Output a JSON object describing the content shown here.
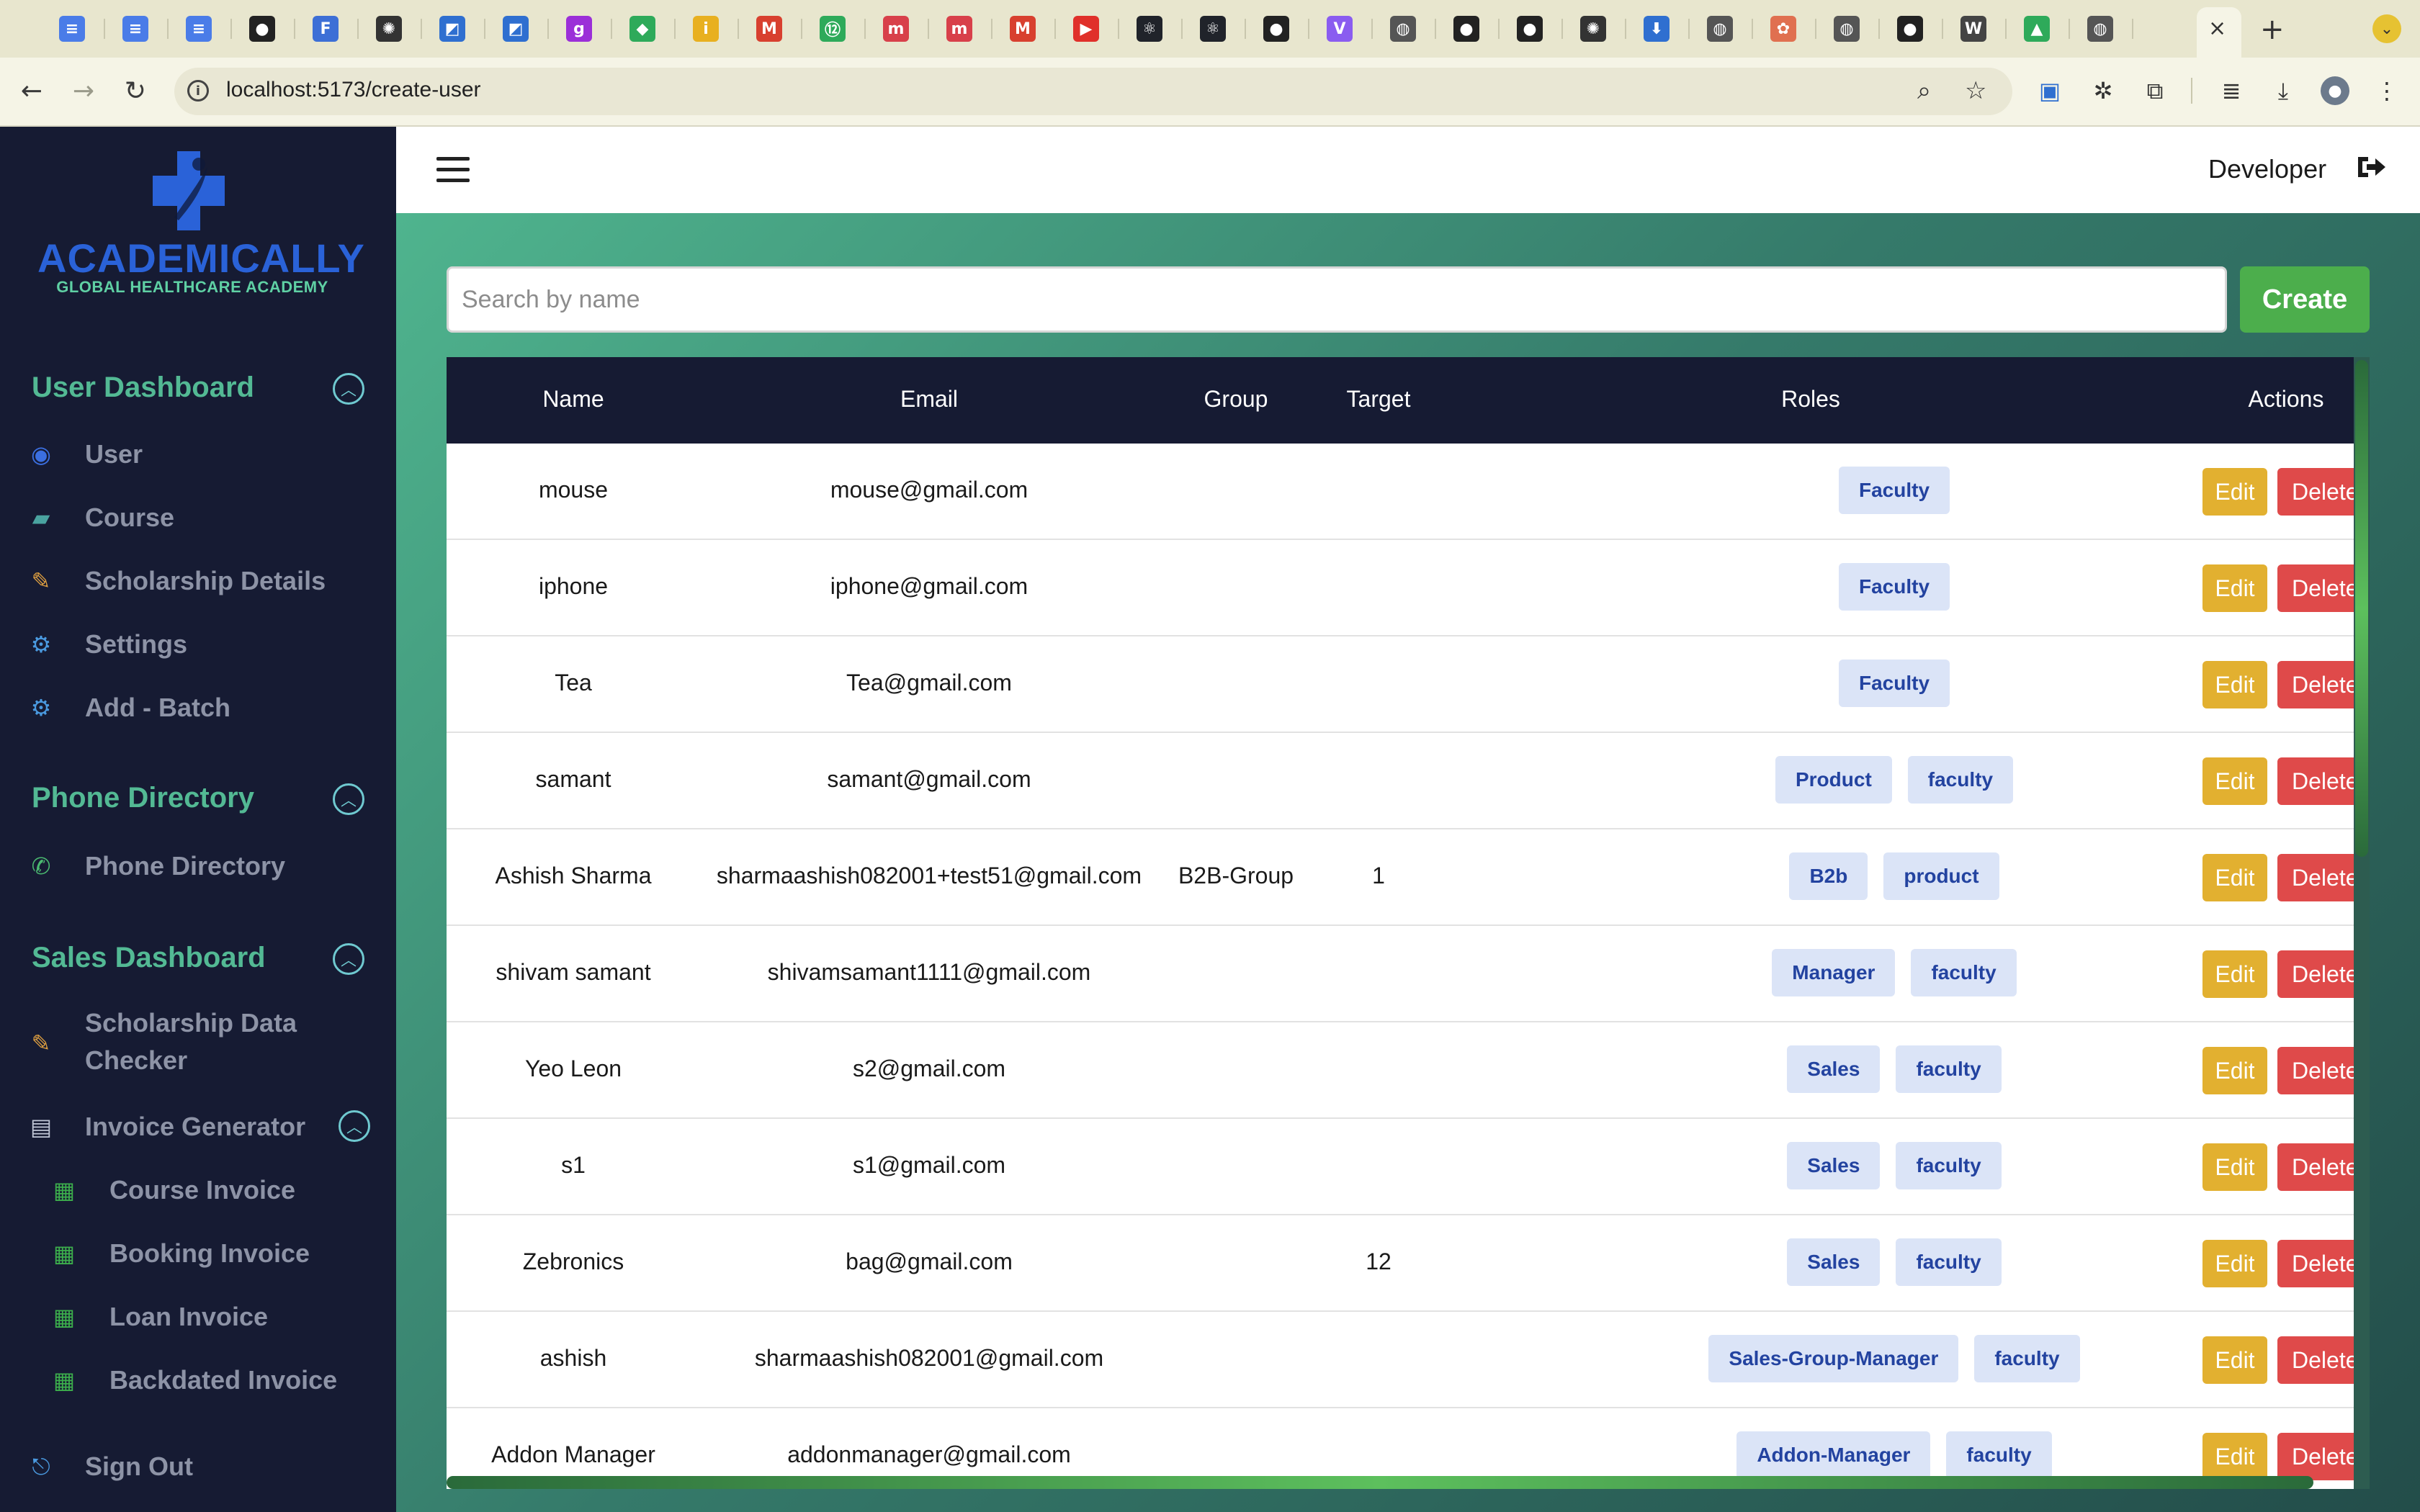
{
  "browser": {
    "url": "localhost:5173/create-user",
    "tabs": [
      {
        "icon": "docs-icon",
        "color": "#4a7ce8",
        "glyph": "≡"
      },
      {
        "icon": "docs-icon",
        "color": "#4a7ce8",
        "glyph": "≡"
      },
      {
        "icon": "docs-icon",
        "color": "#4a7ce8",
        "glyph": "≡"
      },
      {
        "icon": "github-icon",
        "color": "#222222",
        "glyph": "●"
      },
      {
        "icon": "frt-icon",
        "color": "#3d6fd6",
        "glyph": "F"
      },
      {
        "icon": "chatgpt-icon",
        "color": "#333333",
        "glyph": "✺"
      },
      {
        "icon": "sheets-app-icon",
        "color": "#2f6fd0",
        "glyph": "◩"
      },
      {
        "icon": "sheets-app-icon",
        "color": "#2f6fd0",
        "glyph": "◩"
      },
      {
        "icon": "g-icon",
        "color": "#9b2fd8",
        "glyph": "g"
      },
      {
        "icon": "maps-icon",
        "color": "#2eaa5a",
        "glyph": "◆"
      },
      {
        "icon": "idea-icon",
        "color": "#e8b020",
        "glyph": "i"
      },
      {
        "icon": "gmail-icon",
        "color": "#d8402f",
        "glyph": "M"
      },
      {
        "icon": "badge-12-icon",
        "color": "#2eaa5a",
        "glyph": "⑫"
      },
      {
        "icon": "m-icon",
        "color": "#d8404a",
        "glyph": "m"
      },
      {
        "icon": "m-icon",
        "color": "#d8404a",
        "glyph": "m"
      },
      {
        "icon": "gmail-icon",
        "color": "#d8402f",
        "glyph": "M"
      },
      {
        "icon": "youtube-icon",
        "color": "#e0302a",
        "glyph": "▶"
      },
      {
        "icon": "react-icon",
        "color": "#20232a",
        "glyph": "⚛"
      },
      {
        "icon": "react-icon",
        "color": "#20232a",
        "glyph": "⚛"
      },
      {
        "icon": "github-icon",
        "color": "#222222",
        "glyph": "●"
      },
      {
        "icon": "vite-icon",
        "color": "#8a5cf0",
        "glyph": "V"
      },
      {
        "icon": "globe-icon",
        "color": "#555555",
        "glyph": "◍"
      },
      {
        "icon": "github-icon",
        "color": "#222222",
        "glyph": "●"
      },
      {
        "icon": "github-icon",
        "color": "#222222",
        "glyph": "●"
      },
      {
        "icon": "chatgpt-icon",
        "color": "#333333",
        "glyph": "✺"
      },
      {
        "icon": "download-icon",
        "color": "#2f6fd0",
        "glyph": "⬇"
      },
      {
        "icon": "globe-icon",
        "color": "#555555",
        "glyph": "◍"
      },
      {
        "icon": "squarespace-icon",
        "color": "#e07050",
        "glyph": "✿"
      },
      {
        "icon": "globe-icon",
        "color": "#555555",
        "glyph": "◍"
      },
      {
        "icon": "github-icon",
        "color": "#222222",
        "glyph": "●"
      },
      {
        "icon": "wikipedia-icon",
        "color": "#444444",
        "glyph": "W"
      },
      {
        "icon": "drive-icon",
        "color": "#2eaa5a",
        "glyph": "▲"
      },
      {
        "icon": "globe-icon",
        "color": "#555555",
        "glyph": "◍"
      }
    ]
  },
  "sidebar": {
    "logo_title": "ACADEMICALLY",
    "logo_subtitle": "GLOBAL HEALTHCARE ACADEMY",
    "sections": {
      "user_dashboard": {
        "title": "User Dashboard",
        "items": [
          {
            "label": "User",
            "icon": "user-icon"
          },
          {
            "label": "Course",
            "icon": "course-icon"
          },
          {
            "label": "Scholarship Details",
            "icon": "scholarship-icon"
          },
          {
            "label": "Settings",
            "icon": "gear-icon"
          },
          {
            "label": "Add - Batch",
            "icon": "gear-icon"
          }
        ]
      },
      "phone_directory": {
        "title": "Phone Directory",
        "items": [
          {
            "label": "Phone Directory",
            "icon": "phone-icon"
          }
        ]
      },
      "sales_dashboard": {
        "title": "Sales Dashboard",
        "items": [
          {
            "label_line1": "Scholarship Data",
            "label_line2": "Checker",
            "icon": "scholarship-icon"
          },
          {
            "label": "Invoice Generator",
            "icon": "invoice-icon"
          }
        ],
        "invoice_items": [
          {
            "label": "Course Invoice",
            "icon": "document-icon"
          },
          {
            "label": "Booking Invoice",
            "icon": "document-icon"
          },
          {
            "label": "Loan Invoice",
            "icon": "document-icon"
          },
          {
            "label": "Backdated Invoice",
            "icon": "document-icon"
          }
        ]
      }
    },
    "sign_out": "Sign Out"
  },
  "header": {
    "user_name": "Developer"
  },
  "search": {
    "placeholder": "Search by name"
  },
  "create_label": "Create",
  "table": {
    "columns": [
      "Name",
      "Email",
      "Group",
      "Target",
      "Roles",
      "Actions"
    ],
    "edit_label": "Edit",
    "delete_label": "Delete",
    "rows": [
      {
        "name": "mouse",
        "email": "mouse@gmail.com",
        "group": "",
        "target": "",
        "roles": [
          "Faculty"
        ]
      },
      {
        "name": "iphone",
        "email": "iphone@gmail.com",
        "group": "",
        "target": "",
        "roles": [
          "Faculty"
        ]
      },
      {
        "name": "Tea",
        "email": "Tea@gmail.com",
        "group": "",
        "target": "",
        "roles": [
          "Faculty"
        ]
      },
      {
        "name": "samant",
        "email": "samant@gmail.com",
        "group": "",
        "target": "",
        "roles": [
          "Product",
          "faculty"
        ]
      },
      {
        "name": "Ashish Sharma",
        "email": "sharmaashish082001+test51@gmail.com",
        "group": "B2B-Group",
        "target": "1",
        "roles": [
          "B2b",
          "product"
        ]
      },
      {
        "name": "shivam samant",
        "email": "shivamsamant1111@gmail.com",
        "group": "",
        "target": "",
        "roles": [
          "Manager",
          "faculty"
        ]
      },
      {
        "name": "Yeo Leon",
        "email": "s2@gmail.com",
        "group": "",
        "target": "",
        "roles": [
          "Sales",
          "faculty"
        ]
      },
      {
        "name": "s1",
        "email": "s1@gmail.com",
        "group": "",
        "target": "",
        "roles": [
          "Sales",
          "faculty"
        ]
      },
      {
        "name": "Zebronics",
        "email": "bag@gmail.com",
        "group": "",
        "target": "12",
        "roles": [
          "Sales",
          "faculty"
        ]
      },
      {
        "name": "ashish",
        "email": "sharmaashish082001@gmail.com",
        "group": "",
        "target": "",
        "roles": [
          "Sales-Group-Manager",
          "faculty"
        ]
      },
      {
        "name": "Addon Manager",
        "email": "addonmanager@gmail.com",
        "group": "",
        "target": "",
        "roles": [
          "Addon-Manager",
          "faculty"
        ]
      }
    ]
  }
}
